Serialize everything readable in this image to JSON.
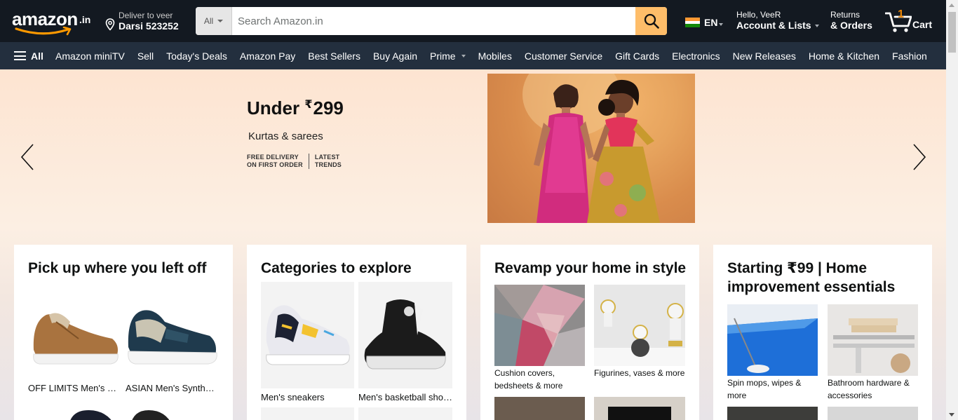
{
  "header": {
    "logo_text": "amazon",
    "logo_tld": ".in",
    "deliver_line1": "Deliver to veer",
    "deliver_line2": "Darsi 523252",
    "search": {
      "category": "All",
      "placeholder": "Search Amazon.in",
      "value": ""
    },
    "language": "EN",
    "account_line1": "Hello, VeeR",
    "account_line2": "Account & Lists",
    "orders_line1": "Returns",
    "orders_line2": "& Orders",
    "cart_count": "1",
    "cart_label": "Cart",
    "colors": {
      "bar": "#131921",
      "nav": "#232f3e",
      "search_button": "#febd69",
      "accent": "#f08804"
    }
  },
  "nav": {
    "all_label": "All",
    "links": [
      "Amazon miniTV",
      "Sell",
      "Today's Deals",
      "Amazon Pay",
      "Best Sellers",
      "Buy Again",
      "Prime",
      "Mobiles",
      "Customer Service",
      "Gift Cards",
      "Electronics",
      "New Releases",
      "Home & Kitchen",
      "Fashion"
    ]
  },
  "hero": {
    "headline_prefix": "Under ",
    "currency": "₹",
    "price": "299",
    "subtitle": "Kurtas & sarees",
    "fine_left_1": "FREE DELIVERY",
    "fine_left_2": "ON FIRST ORDER",
    "fine_right_1": "LATEST",
    "fine_right_2": "TRENDS"
  },
  "cards": [
    {
      "title": "Pick up where you left off",
      "items": [
        {
          "caption": "OFF LIMITS Men's Sports Running Shoes"
        },
        {
          "caption": "ASIAN Men's Synthetic Sports Shoes"
        }
      ]
    },
    {
      "title": "Categories to explore",
      "items": [
        {
          "caption": "Men's sneakers"
        },
        {
          "caption": "Men's basketball shoes"
        }
      ]
    },
    {
      "title": "Revamp your home in style",
      "items": [
        {
          "caption": "Cushion covers, bedsheets & more"
        },
        {
          "caption": "Figurines, vases & more"
        }
      ]
    },
    {
      "title": "Starting ₹99 | Home improvement essentials",
      "items": [
        {
          "caption": "Spin mops, wipes & more"
        },
        {
          "caption": "Bathroom hardware & accessories"
        }
      ]
    }
  ]
}
